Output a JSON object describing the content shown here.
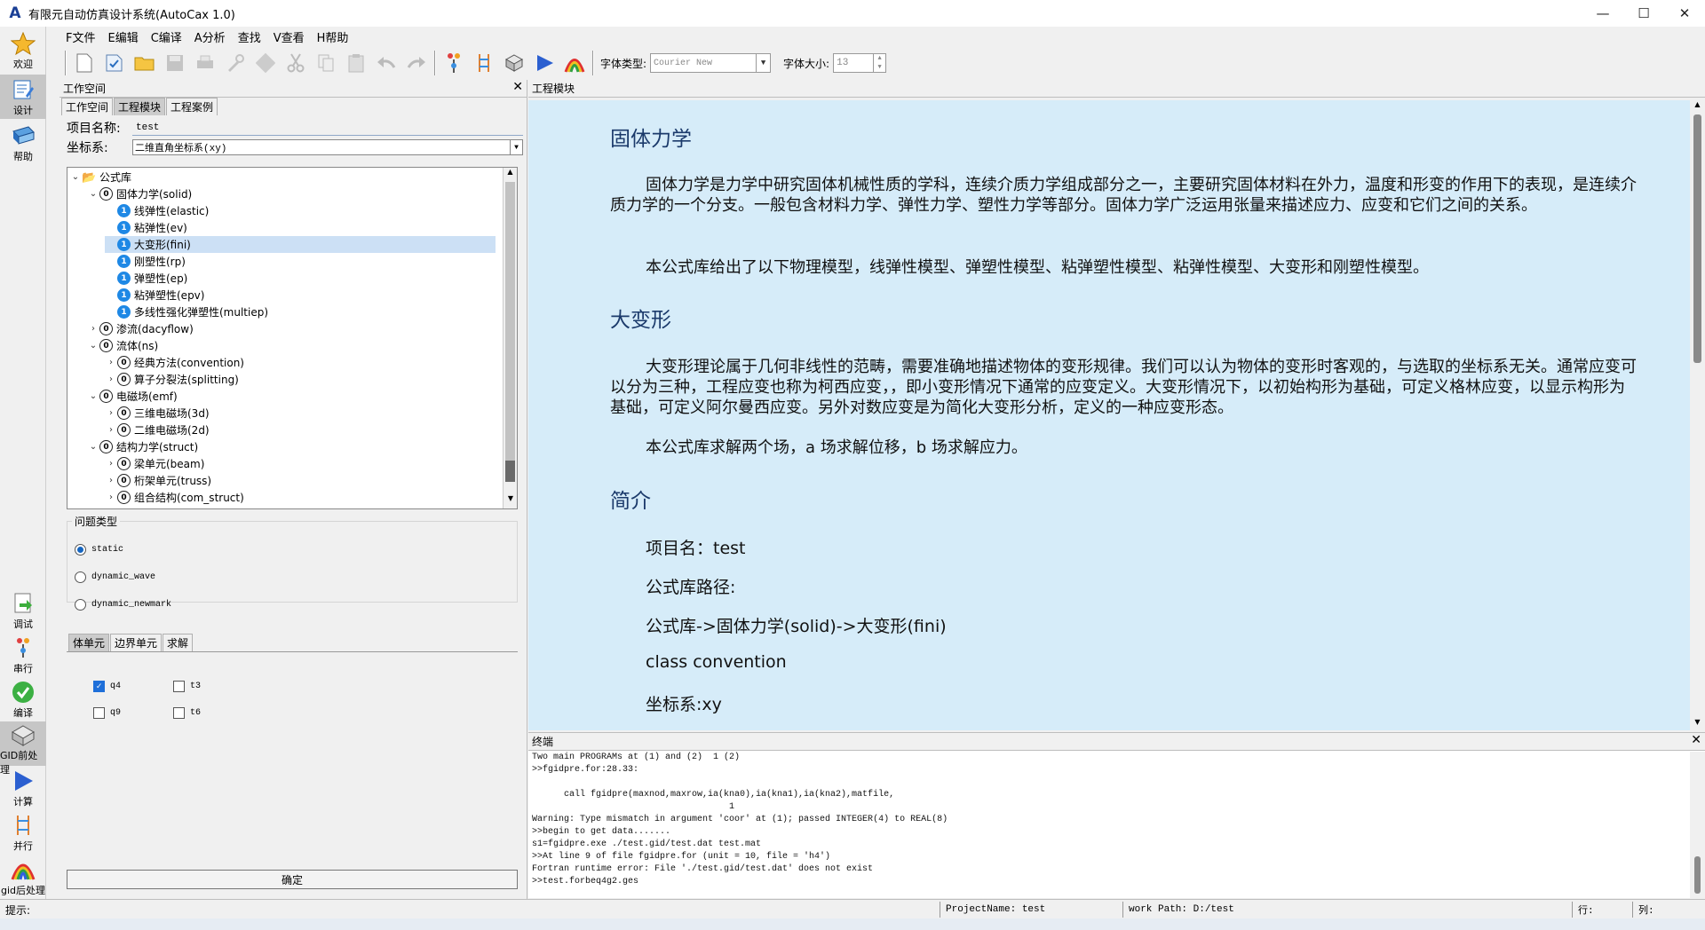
{
  "window": {
    "title": "有限元自动仿真设计系统(AutoCax 1.0)",
    "minimize": "—",
    "maximize": "☐",
    "close": "✕"
  },
  "menu": [
    "F文件",
    "E编辑",
    "C编译",
    "A分析",
    "查找",
    "V查看",
    "H帮助"
  ],
  "toolbar": {
    "font_type_label": "字体类型:",
    "font_type_value": "Courier New",
    "font_size_label": "字体大小:",
    "font_size_value": "13"
  },
  "left_rail": {
    "top": [
      {
        "label": "欢迎",
        "icon": "star-icon"
      },
      {
        "label": "设计",
        "icon": "design-icon"
      },
      {
        "label": "帮助",
        "icon": "help-book-icon"
      }
    ],
    "bottom": [
      {
        "label": "调试",
        "icon": "debug-icon"
      },
      {
        "label": "串行",
        "icon": "serial-icon"
      },
      {
        "label": "编译",
        "icon": "compile-check-icon"
      },
      {
        "label": "GID前处理",
        "icon": "gid-pre-icon"
      },
      {
        "label": "计算",
        "icon": "play-icon"
      },
      {
        "label": "并行",
        "icon": "parallel-icon"
      },
      {
        "label": "gid后处理",
        "icon": "gid-post-icon"
      }
    ]
  },
  "workspace": {
    "header": "工作空间",
    "tabs": [
      "工作空间",
      "工程模块",
      "工程案例"
    ],
    "selected_tab": 1,
    "project_name_label": "项目名称:",
    "project_name_value": "test",
    "coord_label": "坐标系:",
    "coord_value": "二维直角坐标系(xy)",
    "tree": [
      {
        "level": 0,
        "twisty": "⌄",
        "type": "folder",
        "label": "公式库"
      },
      {
        "level": 1,
        "twisty": "⌄",
        "type": "node",
        "label": "固体力学(solid)"
      },
      {
        "level": 2,
        "twisty": "",
        "type": "leaf",
        "label": "线弹性(elastic)"
      },
      {
        "level": 2,
        "twisty": "",
        "type": "leaf",
        "label": "粘弹性(ev)"
      },
      {
        "level": 2,
        "twisty": "",
        "type": "leaf",
        "label": "大变形(fini)",
        "selected": true
      },
      {
        "level": 2,
        "twisty": "",
        "type": "leaf",
        "label": "刚塑性(rp)"
      },
      {
        "level": 2,
        "twisty": "",
        "type": "leaf",
        "label": "弹塑性(ep)"
      },
      {
        "level": 2,
        "twisty": "",
        "type": "leaf",
        "label": "粘弹塑性(epv)"
      },
      {
        "level": 2,
        "twisty": "",
        "type": "leaf",
        "label": "多线性强化弹塑性(multiep)"
      },
      {
        "level": 1,
        "twisty": "›",
        "type": "node",
        "label": "渗流(dacyflow)"
      },
      {
        "level": 1,
        "twisty": "⌄",
        "type": "node",
        "label": "流体(ns)"
      },
      {
        "level": 2,
        "twisty": "›",
        "type": "node",
        "label": "经典方法(convention)"
      },
      {
        "level": 2,
        "twisty": "›",
        "type": "node",
        "label": "算子分裂法(splitting)"
      },
      {
        "level": 1,
        "twisty": "⌄",
        "type": "node",
        "label": "电磁场(emf)"
      },
      {
        "level": 2,
        "twisty": "›",
        "type": "node",
        "label": "三维电磁场(3d)"
      },
      {
        "level": 2,
        "twisty": "›",
        "type": "node",
        "label": "二维电磁场(2d)"
      },
      {
        "level": 1,
        "twisty": "⌄",
        "type": "node",
        "label": "结构力学(struct)"
      },
      {
        "level": 2,
        "twisty": "›",
        "type": "node",
        "label": "梁单元(beam)"
      },
      {
        "level": 2,
        "twisty": "›",
        "type": "node",
        "label": "桁架单元(truss)"
      },
      {
        "level": 2,
        "twisty": "›",
        "type": "node",
        "label": "组合结构(com_struct)"
      }
    ],
    "problem_type_title": "问题类型",
    "problem_types": [
      {
        "label": "static",
        "checked": true
      },
      {
        "label": "dynamic_wave",
        "checked": false
      },
      {
        "label": "dynamic_newmark",
        "checked": false
      }
    ],
    "element_tabs": [
      "体单元",
      "边界单元",
      "求解"
    ],
    "selected_element_tab": 0,
    "elements": [
      {
        "label": "q4",
        "checked": true
      },
      {
        "label": "t3",
        "checked": false
      },
      {
        "label": "q9",
        "checked": false
      },
      {
        "label": "t6",
        "checked": false
      }
    ],
    "ok_label": "确定"
  },
  "module": {
    "header": "工程模块",
    "h1": "固体力学",
    "p1": "固体力学是力学中研究固体机械性质的学科，连续介质力学组成部分之一，主要研究固体材料在外力，温度和形变的作用下的表现，是连续介质力学的一个分支。一般包含材料力学、弹性力学、塑性力学等部分。固体力学广泛运用张量来描述应力、应变和它们之间的关系。",
    "p2": "本公式库给出了以下物理模型，线弹性模型、弹塑性模型、粘弹塑性模型、粘弹性模型、大变形和刚塑性模型。",
    "h2": "大变形",
    "p3": "大变形理论属于几何非线性的范畴，需要准确地描述物体的变形规律。我们可以认为物体的变形时客观的，与选取的坐标系无关。通常应变可以分为三种，工程应变也称为柯西应变，，即小变形情况下通常的应变定义。大变形情况下，以初始构形为基础，可定义格林应变，以显示构形为基础，可定义阿尔曼西应变。另外对数应变是为简化大变形分析，定义的一种应变形态。",
    "p4": "本公式库求解两个场，a 场求解位移，b 场求解应力。",
    "h3": "简介",
    "l1": "项目名：test",
    "l2": "公式库路径:",
    "l3": "公式库->固体力学(solid)->大变形(fini)",
    "l4": "class convention",
    "l5": "坐标系:xy"
  },
  "terminal": {
    "header": "终端",
    "lines": [
      "Two main PROGRAMs at (1) and (2)  1 (2)",
      ">>fgidpre.for:28.33:",
      "",
      "      call fgidpre(maxnod,maxrow,ia(kna0),ia(kna1),ia(kna2),matfile,",
      "                                     1",
      "Warning: Type mismatch in argument 'coor' at (1); passed INTEGER(4) to REAL(8)",
      ">>begin to get data.......",
      "s1=fgidpre.exe ./test.gid/test.dat test.mat",
      ">>At line 9 of file fgidpre.for (unit = 10, file = 'h4')",
      "Fortran runtime error: File './test.gid/test.dat' does not exist",
      ">>test.forbeq4g2.ges"
    ]
  },
  "status": {
    "hint": "提示:",
    "project": "ProjectName: test",
    "workpath": "work Path: D:/test",
    "row": "行:",
    "col": "列:"
  }
}
